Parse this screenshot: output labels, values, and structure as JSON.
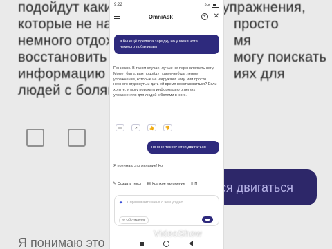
{
  "background": {
    "lines": [
      "подойдут какие-нибудь легкие упражнения,",
      "которые не на",
      "немного отдох",
      "восстановить",
      "информацию о",
      "людей с болям"
    ],
    "lines_right": [
      "",
      "просто",
      "мя",
      "могу поискать",
      "иях для",
      ""
    ],
    "pill_text": "ся двигаться",
    "bottom_text": "Я понимаю это"
  },
  "statusbar": {
    "time": "9:22",
    "signal": "5G",
    "battery": "35"
  },
  "appbar": {
    "title": "OmniAsk",
    "menu_icon": "hamburger-menu-icon",
    "newchat_icon": "new-chat-icon",
    "close_icon": "close-icon"
  },
  "conversation": {
    "user_msg_1": "я бы ещё сделала зарядку но у меня нога немного побаливает",
    "assistant_msg_1": "Понимаю. В таком случае, лучше не перенапрягать ногу. Может быть, вам подойдут какие-нибудь легкие упражнения, которые не нагружают ногу, или просто немного отдохнуть и дать ей время восстановиться? Если хотите, я могу поискать информацию о легких упражнениях для людей с болями в ноге.",
    "actions": [
      {
        "name": "copy-icon",
        "glyph": "⧉"
      },
      {
        "name": "share-icon",
        "glyph": "↗"
      },
      {
        "name": "like-icon",
        "glyph": "👍"
      },
      {
        "name": "dislike-icon",
        "glyph": "👎"
      }
    ],
    "user_msg_2": "но мне так хочется двигаться",
    "assistant_typing": "Я понимаю это желание! Ко"
  },
  "chips": {
    "create_text": "Создать текст",
    "summary": "Краткое изложение",
    "more": "П"
  },
  "input": {
    "placeholder": "Спрашивайте меня о чем угодно",
    "search_chip": "Обсуждение"
  },
  "watermark": "VideoShow"
}
